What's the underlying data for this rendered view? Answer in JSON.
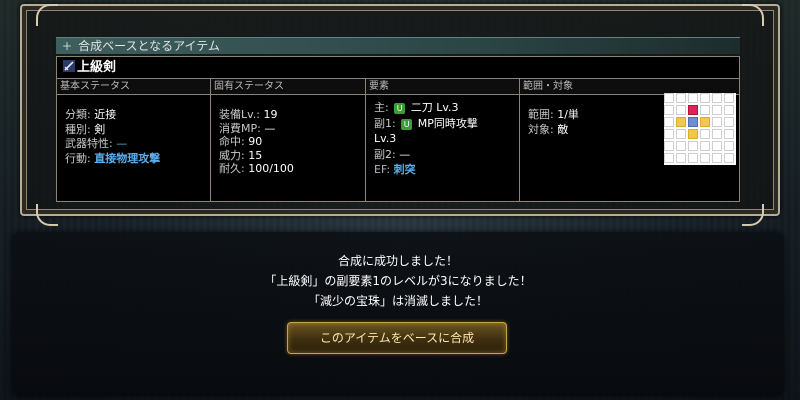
{
  "section_header": "合成ベースとなるアイテム",
  "item": {
    "name": "上級剣"
  },
  "columns": {
    "basic": {
      "header": "基本ステータス",
      "rows": [
        {
          "label": "分類:",
          "value": "近接"
        },
        {
          "label": "種別:",
          "value": "剣"
        },
        {
          "label": "武器特性:",
          "value": "—"
        },
        {
          "label": "行動:",
          "value": "直接物理攻撃"
        }
      ]
    },
    "unique": {
      "header": "固有ステータス",
      "rows": [
        {
          "label": "装備Lv.:",
          "value": "19"
        },
        {
          "label": "消費MP:",
          "value": "—"
        },
        {
          "label": "命中:",
          "value": "90"
        },
        {
          "label": "威力:",
          "value": "15"
        },
        {
          "label": "耐久:",
          "value": "100/100"
        }
      ]
    },
    "elements": {
      "header": "要素",
      "main_label": "主:",
      "main_badge": "U",
      "main_value": "二刀 Lv.3",
      "sub1_label": "副1:",
      "sub1_badge": "U",
      "sub1_value": "MP同時攻撃",
      "sub1_level": "Lv.3",
      "sub2_label": "副2:",
      "sub2_value": "—",
      "ef_label": "EF:",
      "ef_value": "刺突"
    },
    "range": {
      "header": "範囲・対象",
      "range_label": "範囲:",
      "range_value": "1/単",
      "target_label": "対象:",
      "target_value": "敵"
    }
  },
  "dialog": {
    "line1": "合成に成功しました！",
    "line2": "「上級剣」の副要素1のレベルが3になりました！",
    "line3": "「減少の宝珠」は消滅しました！",
    "button_label": "このアイテムをベースに合成"
  },
  "colors": {
    "accent_blue": "#5aaeee",
    "target_cell": "#d9245c",
    "area_cell": "#f2c84a",
    "self_cell": "#6b8fd0",
    "badge_green": "#3f9a3a"
  }
}
